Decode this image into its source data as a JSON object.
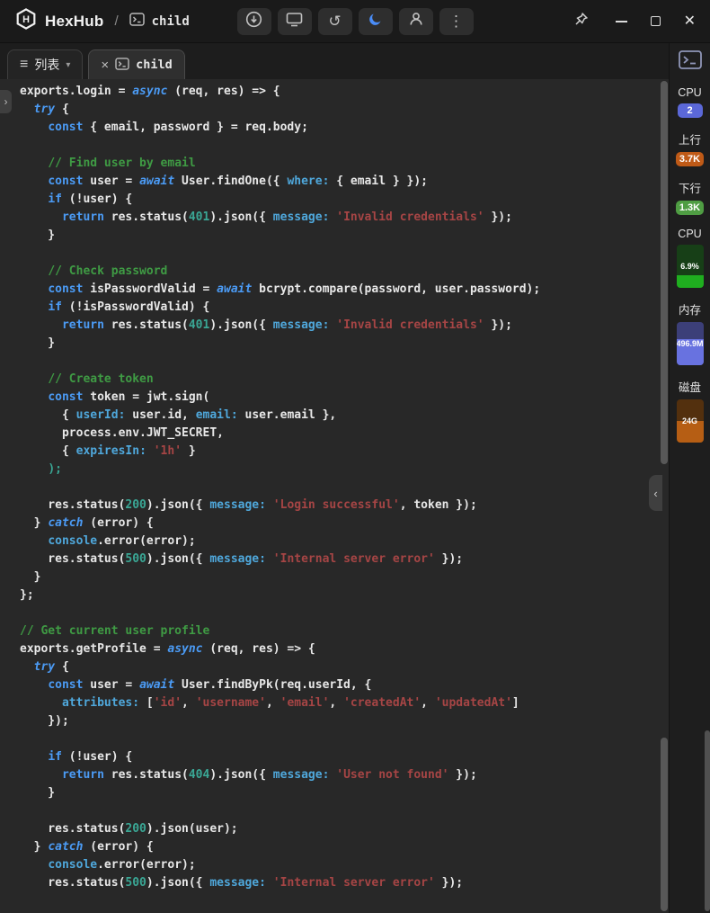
{
  "colors": {
    "titlebar_bg": "#1a1a1a",
    "editor_bg": "#282828",
    "accent_blue": "#4a8df8",
    "keyword_blue": "#4b9bf5",
    "comment_green": "#3f9b44",
    "string_red": "#a64545",
    "property_cyan": "#4fa8dc",
    "number_teal": "#3aa795"
  },
  "glyphs": {
    "history": "↺",
    "more": "⋮",
    "menu": "≡",
    "caret": "▾",
    "tab_close": "×",
    "window_close": "✕",
    "collapse": "‹",
    "expand": "›"
  },
  "titlebar": {
    "app_name": "HexHub",
    "path_separator": "/",
    "session_name": "child",
    "toolbar_icons": [
      "import-circle-icon",
      "display-icon",
      "history-icon",
      "moon-icon",
      "user-icon",
      "more-icon"
    ]
  },
  "tabbar": {
    "list_tab": {
      "label": "列表"
    },
    "active_tab": {
      "label": "child"
    }
  },
  "sidebar": {
    "stats": [
      {
        "label": "CPU",
        "value": "2",
        "kind": "badge",
        "color": "#5b68d8"
      },
      {
        "label": "上行",
        "value": "3.7K",
        "kind": "badge",
        "color": "#bf5a17"
      },
      {
        "label": "下行",
        "value": "1.3K",
        "kind": "badge",
        "color": "#4f9d43"
      },
      {
        "label": "CPU",
        "value": "6.9%",
        "kind": "gauge",
        "fill_pct": 30,
        "fill": "#1fae1f",
        "bg": "#173f17"
      },
      {
        "label": "内存",
        "value": "496.9M",
        "kind": "gauge",
        "fill_pct": 60,
        "fill": "#6872e0",
        "bg": "#3c3f78"
      },
      {
        "label": "磁盘",
        "value": "24G",
        "kind": "gauge",
        "fill_pct": 50,
        "fill": "#b65e14",
        "bg": "#53300e"
      }
    ]
  },
  "editor": {
    "lines": [
      [
        [
          "p",
          "exports.login = "
        ],
        [
          "ki",
          "async"
        ],
        [
          "p",
          " (req, res) => {"
        ]
      ],
      [
        [
          "p",
          "  "
        ],
        [
          "ki",
          "try"
        ],
        [
          "p",
          " {"
        ]
      ],
      [
        [
          "p",
          "    "
        ],
        [
          "k",
          "const"
        ],
        [
          "p",
          " { email, password } = req.body;"
        ]
      ],
      [],
      [
        [
          "p",
          "    "
        ],
        [
          "c",
          "// Find user by email"
        ]
      ],
      [
        [
          "p",
          "    "
        ],
        [
          "k",
          "const"
        ],
        [
          "p",
          " user = "
        ],
        [
          "ki",
          "await"
        ],
        [
          "p",
          " User.findOne({ "
        ],
        [
          "pr",
          "where:"
        ],
        [
          "p",
          " { email } });"
        ]
      ],
      [
        [
          "p",
          "    "
        ],
        [
          "k",
          "if"
        ],
        [
          "p",
          " (!user) {"
        ]
      ],
      [
        [
          "p",
          "      "
        ],
        [
          "k",
          "return"
        ],
        [
          "p",
          " res.status("
        ],
        [
          "n",
          "401"
        ],
        [
          "p",
          ").json({ "
        ],
        [
          "pr",
          "message:"
        ],
        [
          "p",
          " "
        ],
        [
          "s",
          "'Invalid credentials'"
        ],
        [
          "p",
          " });"
        ]
      ],
      [
        [
          "p",
          "    }"
        ]
      ],
      [],
      [
        [
          "p",
          "    "
        ],
        [
          "c",
          "// Check password"
        ]
      ],
      [
        [
          "p",
          "    "
        ],
        [
          "k",
          "const"
        ],
        [
          "p",
          " isPasswordValid = "
        ],
        [
          "ki",
          "await"
        ],
        [
          "p",
          " bcrypt.compare(password, user.password);"
        ]
      ],
      [
        [
          "p",
          "    "
        ],
        [
          "k",
          "if"
        ],
        [
          "p",
          " (!isPasswordValid) {"
        ]
      ],
      [
        [
          "p",
          "      "
        ],
        [
          "k",
          "return"
        ],
        [
          "p",
          " res.status("
        ],
        [
          "n",
          "401"
        ],
        [
          "p",
          ").json({ "
        ],
        [
          "pr",
          "message:"
        ],
        [
          "p",
          " "
        ],
        [
          "s",
          "'Invalid credentials'"
        ],
        [
          "p",
          " });"
        ]
      ],
      [
        [
          "p",
          "    }"
        ]
      ],
      [],
      [
        [
          "p",
          "    "
        ],
        [
          "c",
          "// Create token"
        ]
      ],
      [
        [
          "p",
          "    "
        ],
        [
          "k",
          "const"
        ],
        [
          "p",
          " token = jwt.sign("
        ]
      ],
      [
        [
          "p",
          "      { "
        ],
        [
          "pr",
          "userId:"
        ],
        [
          "p",
          " user.id, "
        ],
        [
          "pr",
          "email:"
        ],
        [
          "p",
          " user.email },"
        ]
      ],
      [
        [
          "p",
          "      process.env.JWT_SECRET,"
        ]
      ],
      [
        [
          "p",
          "      { "
        ],
        [
          "pr",
          "expiresIn:"
        ],
        [
          "p",
          " "
        ],
        [
          "s",
          "'1h'"
        ],
        [
          "p",
          " }"
        ]
      ],
      [
        [
          "p",
          "    "
        ],
        [
          "n",
          ");"
        ]
      ],
      [],
      [
        [
          "p",
          "    res.status("
        ],
        [
          "n",
          "200"
        ],
        [
          "p",
          ").json({ "
        ],
        [
          "pr",
          "message:"
        ],
        [
          "p",
          " "
        ],
        [
          "s",
          "'Login successful'"
        ],
        [
          "p",
          ", token });"
        ]
      ],
      [
        [
          "p",
          "  } "
        ],
        [
          "ki",
          "catch"
        ],
        [
          "p",
          " (error) {"
        ]
      ],
      [
        [
          "p",
          "    "
        ],
        [
          "pr",
          "console"
        ],
        [
          "p",
          ".error(error);"
        ]
      ],
      [
        [
          "p",
          "    res.status("
        ],
        [
          "n",
          "500"
        ],
        [
          "p",
          ").json({ "
        ],
        [
          "pr",
          "message:"
        ],
        [
          "p",
          " "
        ],
        [
          "s",
          "'Internal server error'"
        ],
        [
          "p",
          " });"
        ]
      ],
      [
        [
          "p",
          "  }"
        ]
      ],
      [
        [
          "p",
          "};"
        ]
      ],
      [],
      [
        [
          "c",
          "// Get current user profile"
        ]
      ],
      [
        [
          "p",
          "exports.getProfile = "
        ],
        [
          "ki",
          "async"
        ],
        [
          "p",
          " (req, res) => {"
        ]
      ],
      [
        [
          "p",
          "  "
        ],
        [
          "ki",
          "try"
        ],
        [
          "p",
          " {"
        ]
      ],
      [
        [
          "p",
          "    "
        ],
        [
          "k",
          "const"
        ],
        [
          "p",
          " user = "
        ],
        [
          "ki",
          "await"
        ],
        [
          "p",
          " User.findByPk(req.userId, {"
        ]
      ],
      [
        [
          "p",
          "      "
        ],
        [
          "pr",
          "attributes:"
        ],
        [
          "p",
          " ["
        ],
        [
          "s",
          "'id'"
        ],
        [
          "p",
          ", "
        ],
        [
          "s",
          "'username'"
        ],
        [
          "p",
          ", "
        ],
        [
          "s",
          "'email'"
        ],
        [
          "p",
          ", "
        ],
        [
          "s",
          "'createdAt'"
        ],
        [
          "p",
          ", "
        ],
        [
          "s",
          "'updatedAt'"
        ],
        [
          "p",
          "]"
        ]
      ],
      [
        [
          "p",
          "    });"
        ]
      ],
      [],
      [
        [
          "p",
          "    "
        ],
        [
          "k",
          "if"
        ],
        [
          "p",
          " (!user) {"
        ]
      ],
      [
        [
          "p",
          "      "
        ],
        [
          "k",
          "return"
        ],
        [
          "p",
          " res.status("
        ],
        [
          "n",
          "404"
        ],
        [
          "p",
          ").json({ "
        ],
        [
          "pr",
          "message:"
        ],
        [
          "p",
          " "
        ],
        [
          "s",
          "'User not found'"
        ],
        [
          "p",
          " });"
        ]
      ],
      [
        [
          "p",
          "    }"
        ]
      ],
      [],
      [
        [
          "p",
          "    res.status("
        ],
        [
          "n",
          "200"
        ],
        [
          "p",
          ").json(user);"
        ]
      ],
      [
        [
          "p",
          "  } "
        ],
        [
          "ki",
          "catch"
        ],
        [
          "p",
          " (error) {"
        ]
      ],
      [
        [
          "p",
          "    "
        ],
        [
          "pr",
          "console"
        ],
        [
          "p",
          ".error(error);"
        ]
      ],
      [
        [
          "p",
          "    res.status("
        ],
        [
          "n",
          "500"
        ],
        [
          "p",
          ").json({ "
        ],
        [
          "pr",
          "message:"
        ],
        [
          "p",
          " "
        ],
        [
          "s",
          "'Internal server error'"
        ],
        [
          "p",
          " });"
        ]
      ]
    ]
  }
}
